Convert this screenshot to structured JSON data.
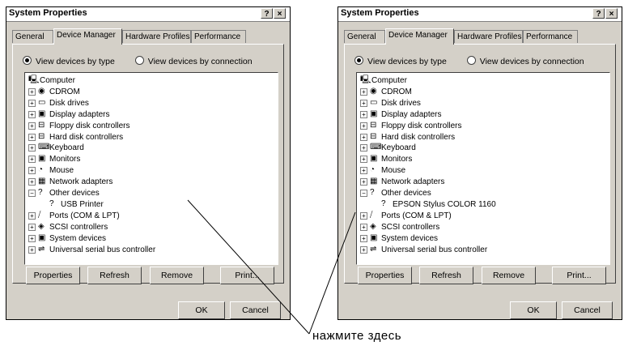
{
  "left": {
    "title": "System Properties",
    "help_btn": "?",
    "close_btn": "×",
    "tabs": [
      "General",
      "Device Manager",
      "Hardware Profiles",
      "Performance"
    ],
    "radio_type": "View devices by type",
    "radio_conn": "View devices by connection",
    "tree": [
      "Computer",
      "CDROM",
      "Disk drives",
      "Display adapters",
      "Floppy disk controllers",
      "Hard disk controllers",
      "Keyboard",
      "Monitors",
      "Mouse",
      "Network adapters",
      "Other devices",
      "USB Printer",
      "Ports (COM & LPT)",
      "SCSI controllers",
      "System devices",
      "Universal serial bus controller"
    ],
    "buttons": [
      "Properties",
      "Refresh",
      "Remove",
      "Print..."
    ],
    "ok": "OK",
    "cancel": "Cancel"
  },
  "right": {
    "title": "System Properties",
    "help_btn": "?",
    "close_btn": "×",
    "tabs": [
      "General",
      "Device Manager",
      "Hardware Profiles",
      "Performance"
    ],
    "radio_type": "View devices by type",
    "radio_conn": "View devices by connection",
    "tree": [
      "Computer",
      "CDROM",
      "Disk drives",
      "Display adapters",
      "Floppy disk controllers",
      "Hard disk controllers",
      "Keyboard",
      "Monitors",
      "Mouse",
      "Network adapters",
      "Other devices",
      "EPSON Stylus COLOR 1160",
      "Ports (COM & LPT)",
      "SCSI controllers",
      "System devices",
      "Universal serial bus controller"
    ],
    "buttons": [
      "Properties",
      "Refresh",
      "Remove",
      "Print..."
    ],
    "ok": "OK",
    "cancel": "Cancel"
  },
  "callout": "нажмите здесь",
  "icons": [
    "computer-icon",
    "cdrom-icon",
    "disk-drive-icon",
    "display-adapter-icon",
    "floppy-controller-icon",
    "hard-disk-controller-icon",
    "keyboard-icon",
    "monitor-icon",
    "mouse-icon",
    "network-adapter-icon",
    "question-device-icon",
    "question-device-icon",
    "port-icon",
    "scsi-icon",
    "system-device-icon",
    "usb-icon"
  ]
}
